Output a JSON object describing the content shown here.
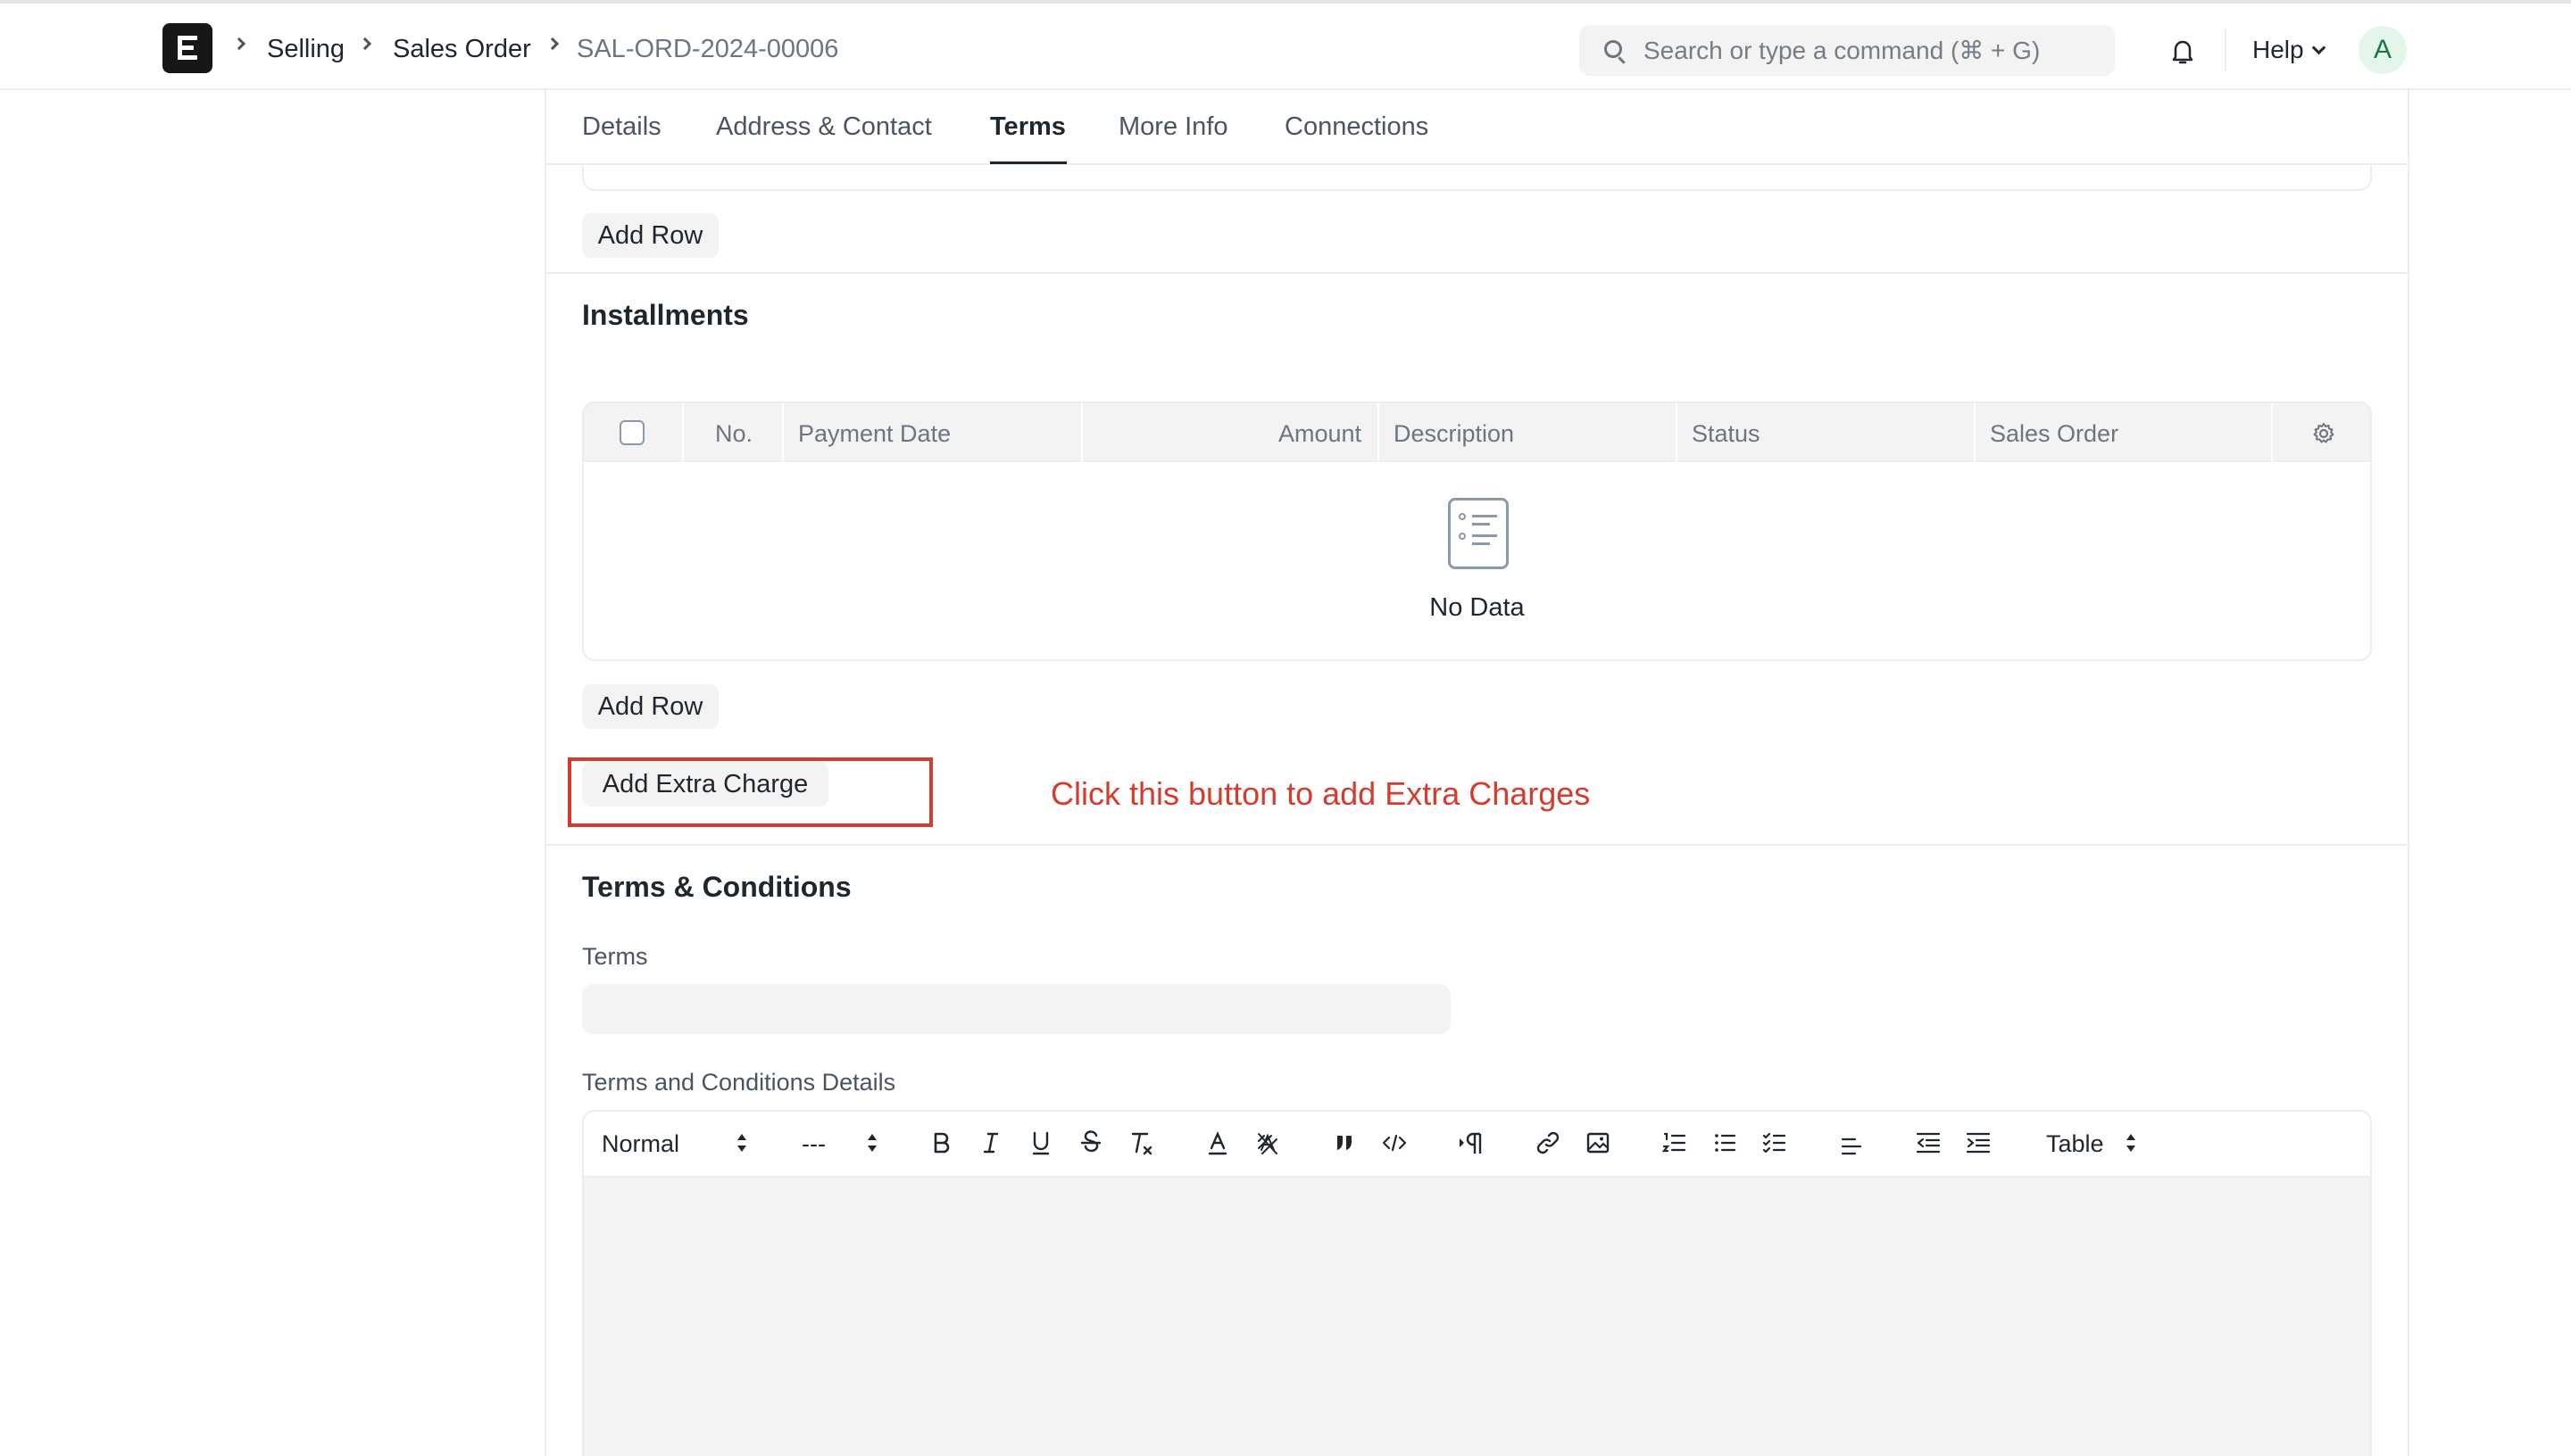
{
  "navbar": {
    "logo_letter": "E",
    "breadcrumbs": [
      "Selling",
      "Sales Order",
      "SAL-ORD-2024-00006"
    ],
    "search_placeholder": "Search or type a command (⌘ + G)",
    "help_label": "Help",
    "avatar_initial": "A"
  },
  "tabs": [
    {
      "label": "Details",
      "active": false
    },
    {
      "label": "Address & Contact",
      "active": false
    },
    {
      "label": "Terms",
      "active": true
    },
    {
      "label": "More Info",
      "active": false
    },
    {
      "label": "Connections",
      "active": false
    }
  ],
  "payment_schedule": {
    "add_row_label": "Add Row"
  },
  "installments": {
    "title": "Installments",
    "columns": [
      "No.",
      "Payment Date",
      "Amount",
      "Description",
      "Status",
      "Sales Order"
    ],
    "rows": [],
    "empty_text": "No Data",
    "add_row_label": "Add Row",
    "add_extra_charge_label": "Add Extra Charge"
  },
  "annotation": {
    "callout_text": "Click this button to add Extra Charges",
    "color": "#d63b2d"
  },
  "terms_section": {
    "title": "Terms & Conditions",
    "terms_label": "Terms",
    "terms_value": "",
    "details_label": "Terms and Conditions Details",
    "editor": {
      "style_select": "Normal",
      "size_select": "---",
      "table_select": "Table",
      "content": ""
    }
  },
  "icons": [
    "search-icon",
    "bell-icon",
    "chevron-down-icon",
    "gear-icon",
    "empty-list-icon",
    "bold-icon",
    "italic-icon",
    "underline-icon",
    "strikethrough-icon",
    "clear-format-icon",
    "text-color-icon",
    "highlight-icon",
    "blockquote-icon",
    "code-icon",
    "paragraph-icon",
    "link-icon",
    "image-icon",
    "ordered-list-icon",
    "bullet-list-icon",
    "check-list-icon",
    "align-icon",
    "outdent-icon",
    "indent-icon"
  ],
  "colors": {
    "accent_dark": "#171717",
    "annotation_red": "#d63b2d",
    "avatar_bg": "#e4f5e9",
    "avatar_text": "#16794c"
  }
}
